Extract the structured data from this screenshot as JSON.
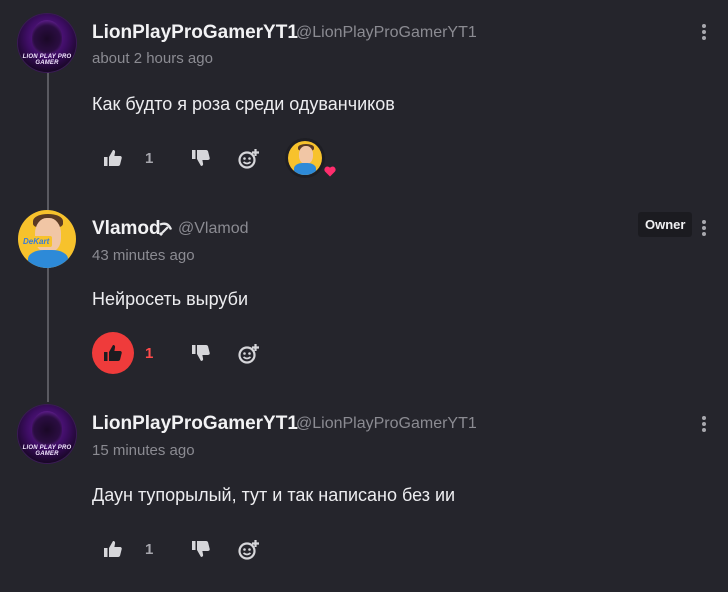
{
  "comments": [
    {
      "author": "LionPlayProGamerYT1",
      "handle": "@LionPlayProGamerYT1",
      "time": "about 2 hours ago",
      "text": "Как будто я роза среди одуванчиков",
      "likes": "1",
      "liked": false,
      "creator_hearted": true,
      "avatar_text": "LION PLAY PRO GAMER",
      "avatar_icon": "lion-avatar-icon"
    },
    {
      "author": "Vlamod",
      "author_badge_icon": "hammer-sickle-icon",
      "handle": "@Vlamod",
      "time": "43 minutes ago",
      "text": "Нейросеть выруби",
      "owner_label": "Owner",
      "likes": "1",
      "liked": true,
      "avatar_text": "DeKart",
      "avatar_icon": "vlamod-avatar-icon"
    },
    {
      "author": "LionPlayProGamerYT1",
      "handle": "@LionPlayProGamerYT1",
      "time": "15 minutes ago",
      "text": "Даун тупорылый, тут и так написано без ии",
      "likes": "1",
      "liked": false,
      "avatar_text": "LION PLAY PRO GAMER",
      "avatar_icon": "lion-avatar-icon"
    }
  ],
  "colors": {
    "background": "#25252c",
    "like_active": "#ef3b3b",
    "heart_badge": "#ff2d6d",
    "muted_text": "#8b8b92"
  },
  "icons": {
    "like": "thumbs-up-icon",
    "dislike": "thumbs-down-icon",
    "react": "add-reaction-icon",
    "menu": "more-vertical-icon"
  }
}
